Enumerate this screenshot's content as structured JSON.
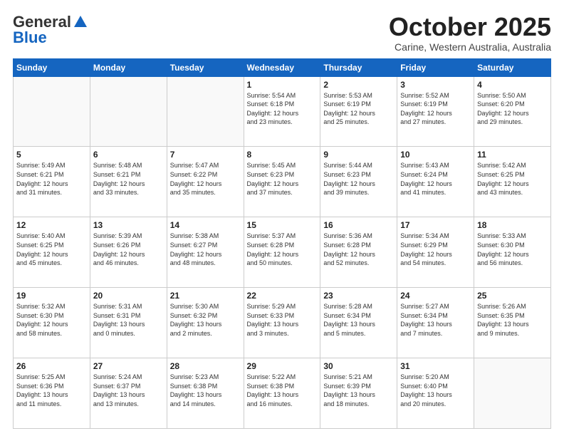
{
  "header": {
    "logo_general": "General",
    "logo_blue": "Blue",
    "title": "October 2025",
    "location": "Carine, Western Australia, Australia"
  },
  "days_of_week": [
    "Sunday",
    "Monday",
    "Tuesday",
    "Wednesday",
    "Thursday",
    "Friday",
    "Saturday"
  ],
  "weeks": [
    [
      {
        "day": "",
        "info": ""
      },
      {
        "day": "",
        "info": ""
      },
      {
        "day": "",
        "info": ""
      },
      {
        "day": "1",
        "info": "Sunrise: 5:54 AM\nSunset: 6:18 PM\nDaylight: 12 hours\nand 23 minutes."
      },
      {
        "day": "2",
        "info": "Sunrise: 5:53 AM\nSunset: 6:19 PM\nDaylight: 12 hours\nand 25 minutes."
      },
      {
        "day": "3",
        "info": "Sunrise: 5:52 AM\nSunset: 6:19 PM\nDaylight: 12 hours\nand 27 minutes."
      },
      {
        "day": "4",
        "info": "Sunrise: 5:50 AM\nSunset: 6:20 PM\nDaylight: 12 hours\nand 29 minutes."
      }
    ],
    [
      {
        "day": "5",
        "info": "Sunrise: 5:49 AM\nSunset: 6:21 PM\nDaylight: 12 hours\nand 31 minutes."
      },
      {
        "day": "6",
        "info": "Sunrise: 5:48 AM\nSunset: 6:21 PM\nDaylight: 12 hours\nand 33 minutes."
      },
      {
        "day": "7",
        "info": "Sunrise: 5:47 AM\nSunset: 6:22 PM\nDaylight: 12 hours\nand 35 minutes."
      },
      {
        "day": "8",
        "info": "Sunrise: 5:45 AM\nSunset: 6:23 PM\nDaylight: 12 hours\nand 37 minutes."
      },
      {
        "day": "9",
        "info": "Sunrise: 5:44 AM\nSunset: 6:23 PM\nDaylight: 12 hours\nand 39 minutes."
      },
      {
        "day": "10",
        "info": "Sunrise: 5:43 AM\nSunset: 6:24 PM\nDaylight: 12 hours\nand 41 minutes."
      },
      {
        "day": "11",
        "info": "Sunrise: 5:42 AM\nSunset: 6:25 PM\nDaylight: 12 hours\nand 43 minutes."
      }
    ],
    [
      {
        "day": "12",
        "info": "Sunrise: 5:40 AM\nSunset: 6:25 PM\nDaylight: 12 hours\nand 45 minutes."
      },
      {
        "day": "13",
        "info": "Sunrise: 5:39 AM\nSunset: 6:26 PM\nDaylight: 12 hours\nand 46 minutes."
      },
      {
        "day": "14",
        "info": "Sunrise: 5:38 AM\nSunset: 6:27 PM\nDaylight: 12 hours\nand 48 minutes."
      },
      {
        "day": "15",
        "info": "Sunrise: 5:37 AM\nSunset: 6:28 PM\nDaylight: 12 hours\nand 50 minutes."
      },
      {
        "day": "16",
        "info": "Sunrise: 5:36 AM\nSunset: 6:28 PM\nDaylight: 12 hours\nand 52 minutes."
      },
      {
        "day": "17",
        "info": "Sunrise: 5:34 AM\nSunset: 6:29 PM\nDaylight: 12 hours\nand 54 minutes."
      },
      {
        "day": "18",
        "info": "Sunrise: 5:33 AM\nSunset: 6:30 PM\nDaylight: 12 hours\nand 56 minutes."
      }
    ],
    [
      {
        "day": "19",
        "info": "Sunrise: 5:32 AM\nSunset: 6:30 PM\nDaylight: 12 hours\nand 58 minutes."
      },
      {
        "day": "20",
        "info": "Sunrise: 5:31 AM\nSunset: 6:31 PM\nDaylight: 13 hours\nand 0 minutes."
      },
      {
        "day": "21",
        "info": "Sunrise: 5:30 AM\nSunset: 6:32 PM\nDaylight: 13 hours\nand 2 minutes."
      },
      {
        "day": "22",
        "info": "Sunrise: 5:29 AM\nSunset: 6:33 PM\nDaylight: 13 hours\nand 3 minutes."
      },
      {
        "day": "23",
        "info": "Sunrise: 5:28 AM\nSunset: 6:34 PM\nDaylight: 13 hours\nand 5 minutes."
      },
      {
        "day": "24",
        "info": "Sunrise: 5:27 AM\nSunset: 6:34 PM\nDaylight: 13 hours\nand 7 minutes."
      },
      {
        "day": "25",
        "info": "Sunrise: 5:26 AM\nSunset: 6:35 PM\nDaylight: 13 hours\nand 9 minutes."
      }
    ],
    [
      {
        "day": "26",
        "info": "Sunrise: 5:25 AM\nSunset: 6:36 PM\nDaylight: 13 hours\nand 11 minutes."
      },
      {
        "day": "27",
        "info": "Sunrise: 5:24 AM\nSunset: 6:37 PM\nDaylight: 13 hours\nand 13 minutes."
      },
      {
        "day": "28",
        "info": "Sunrise: 5:23 AM\nSunset: 6:38 PM\nDaylight: 13 hours\nand 14 minutes."
      },
      {
        "day": "29",
        "info": "Sunrise: 5:22 AM\nSunset: 6:38 PM\nDaylight: 13 hours\nand 16 minutes."
      },
      {
        "day": "30",
        "info": "Sunrise: 5:21 AM\nSunset: 6:39 PM\nDaylight: 13 hours\nand 18 minutes."
      },
      {
        "day": "31",
        "info": "Sunrise: 5:20 AM\nSunset: 6:40 PM\nDaylight: 13 hours\nand 20 minutes."
      },
      {
        "day": "",
        "info": ""
      }
    ]
  ]
}
